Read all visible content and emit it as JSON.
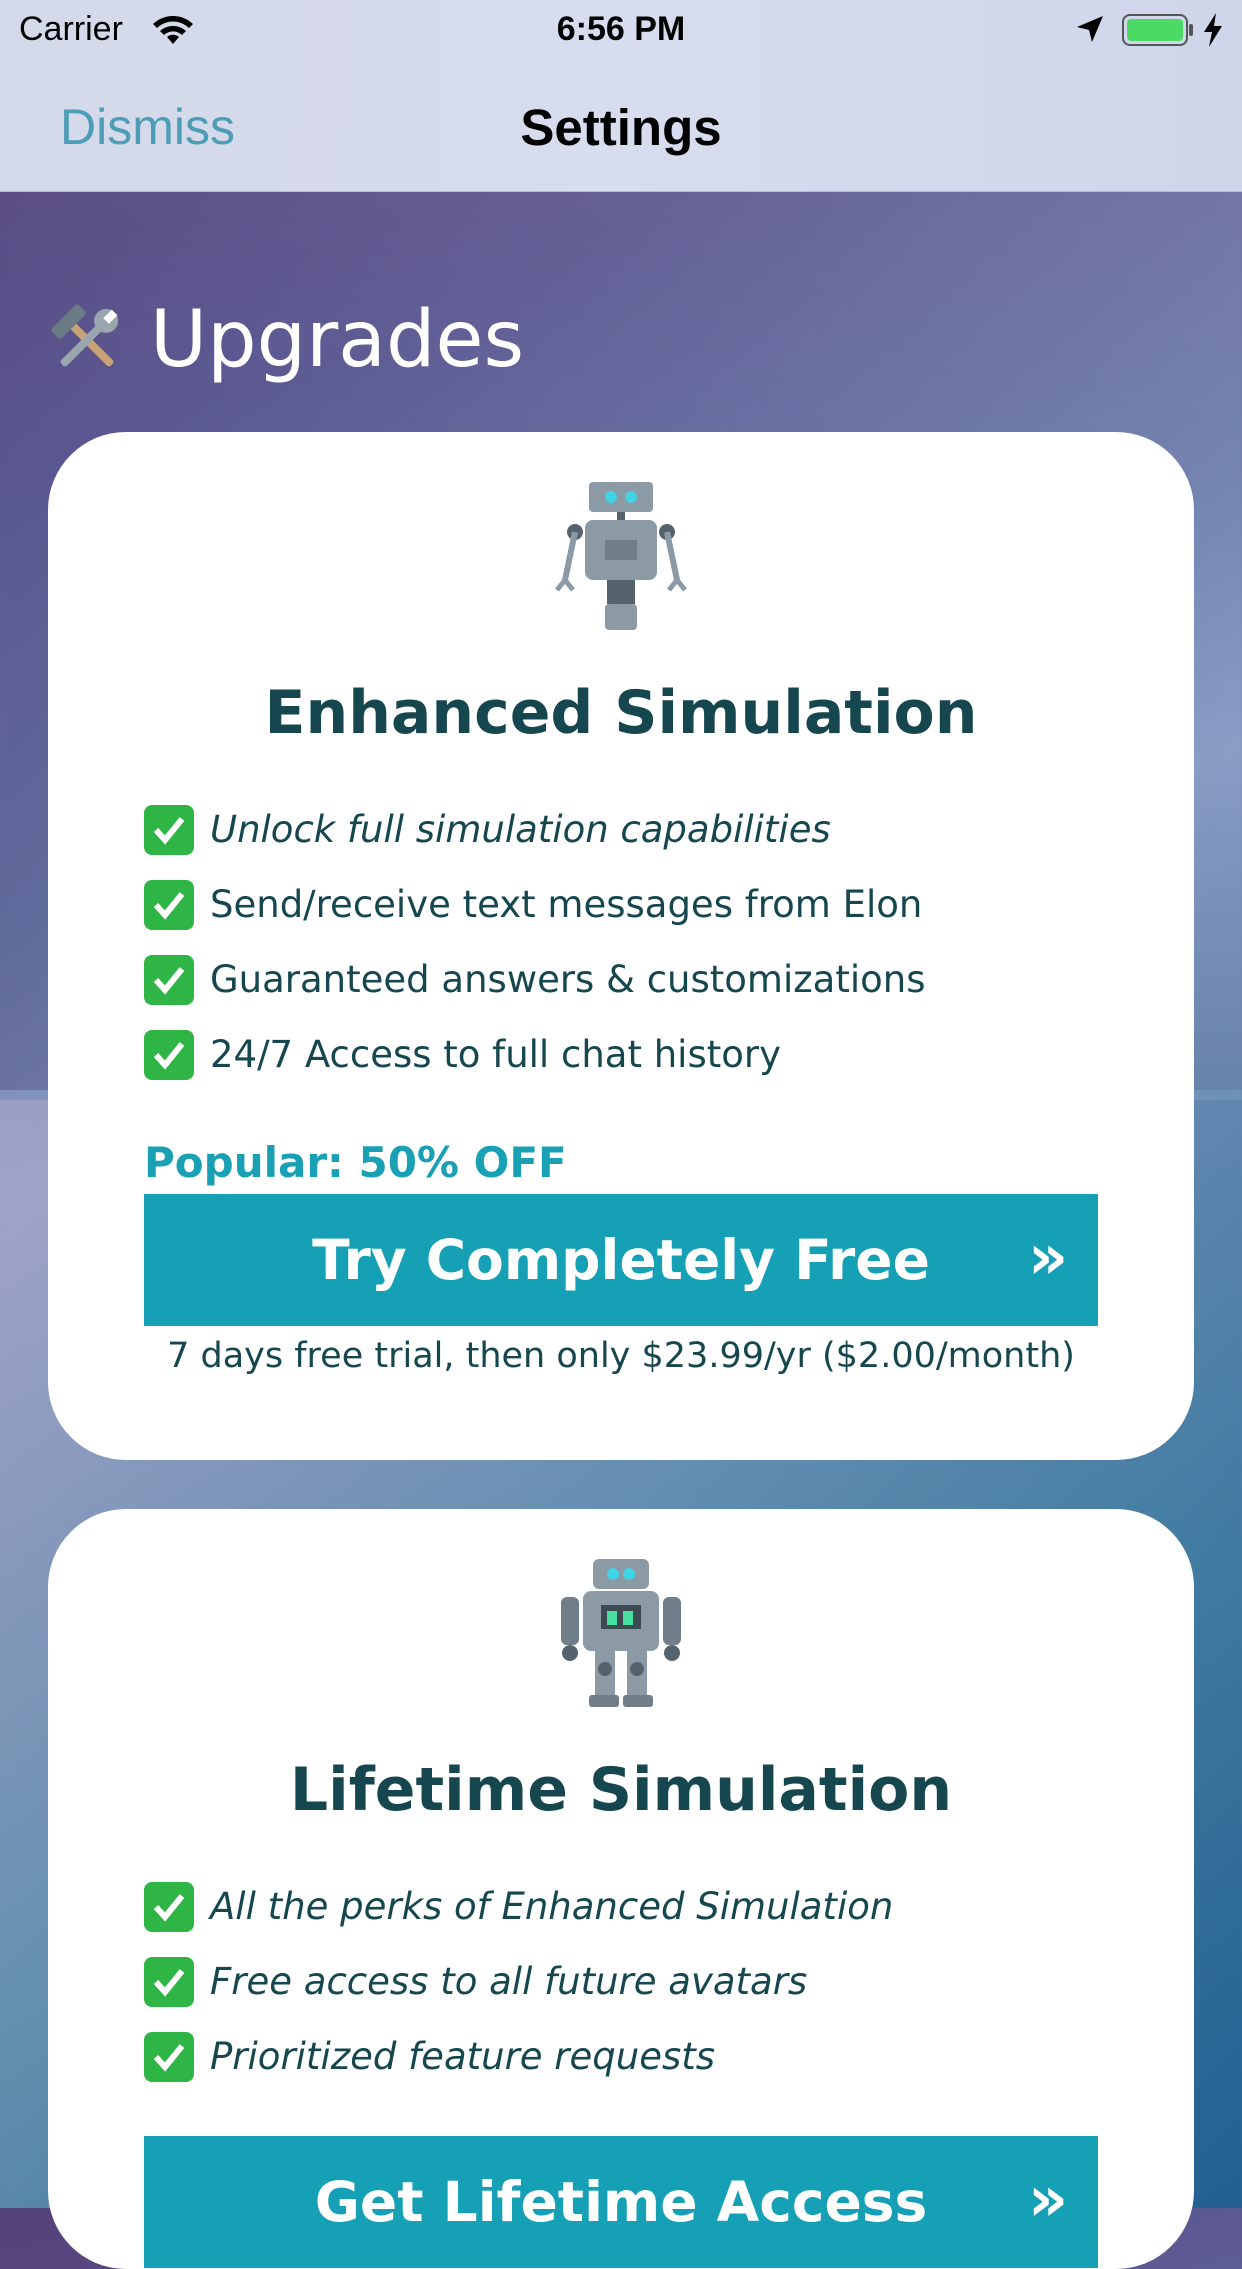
{
  "status_bar": {
    "carrier": "Carrier",
    "time": "6:56 PM",
    "battery_color": "#4cd964"
  },
  "nav": {
    "dismiss_label": "Dismiss",
    "title": "Settings",
    "accent": "#4d9db6"
  },
  "section": {
    "icon": "hammer-and-wrench-icon",
    "title": "Upgrades"
  },
  "cards": [
    {
      "icon": "robot-icon",
      "title": "Enhanced Simulation",
      "features": [
        {
          "text": "Unlock full simulation capabilities",
          "italic": true
        },
        {
          "text": "Send/receive text messages from Elon",
          "italic": false
        },
        {
          "text": "Guaranteed answers & customizations",
          "italic": false
        },
        {
          "text": "24/7 Access to full chat history",
          "italic": false
        }
      ],
      "badge": "Popular: 50% OFF",
      "cta_label": "Try Completely Free",
      "cta_arrow": "»",
      "note": "7 days free trial, then only $23.99/yr ($2.00/month)"
    },
    {
      "icon": "robot-icon",
      "title": "Lifetime Simulation",
      "features": [
        {
          "text": "All the perks of Enhanced Simulation",
          "italic": true
        },
        {
          "text": "Free access to all future avatars",
          "italic": true
        },
        {
          "text": "Prioritized feature requests",
          "italic": true
        }
      ],
      "cta_label": "Get Lifetime Access",
      "cta_arrow": "»"
    }
  ],
  "colors": {
    "card_text": "#16474f",
    "cta": "#16a0b6",
    "badge": "#1aa0b5",
    "check": "#2fb546"
  }
}
